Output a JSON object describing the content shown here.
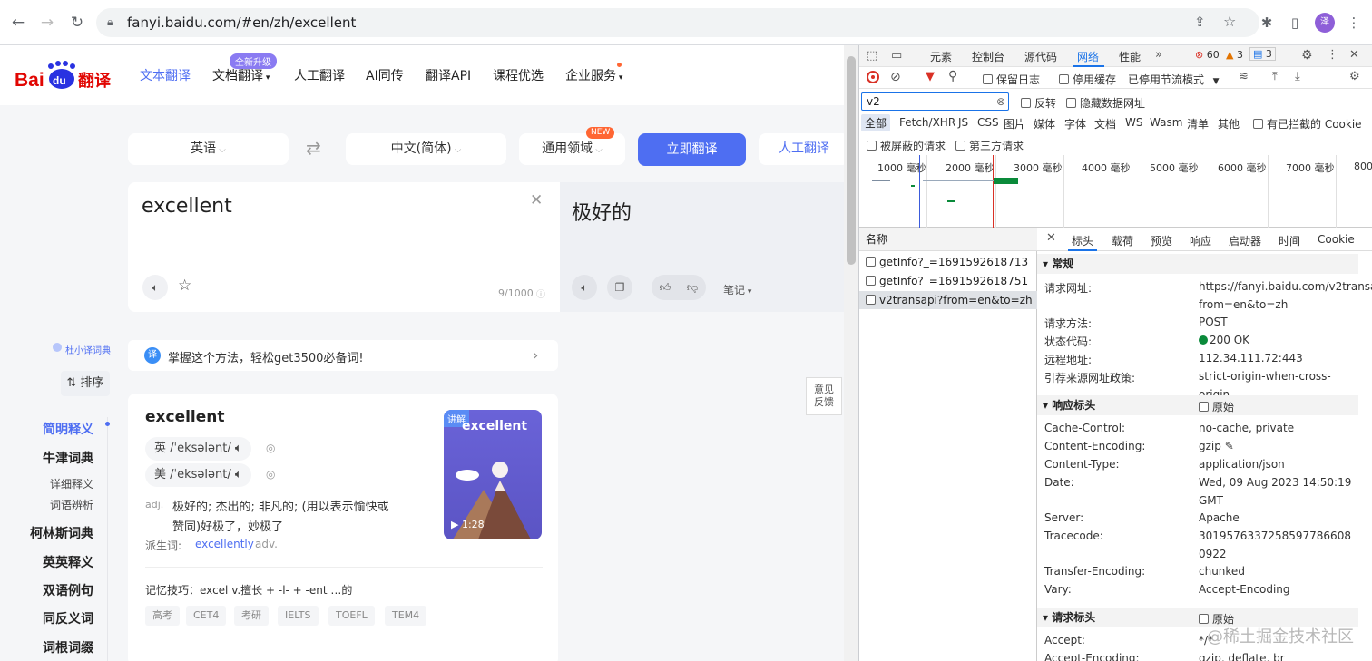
{
  "browser": {
    "url": "fanyi.baidu.com/#en/zh/excellent",
    "profile_initial": "泽"
  },
  "nav": {
    "items": [
      "文本翻译",
      "文档翻译",
      "人工翻译",
      "AI同传",
      "翻译API",
      "课程优选",
      "企业服务"
    ],
    "doc_badge": "全新升级"
  },
  "translator": {
    "source_lang": "英语",
    "target_lang": "中文(简体)",
    "domain": "通用领域",
    "domain_badge": "NEW",
    "translate_button": "立即翻译",
    "human_button": "人工翻译",
    "source_text": "excellent",
    "target_text": "极好的",
    "char_count": "9/1000",
    "notes_label": "笔记"
  },
  "banner": {
    "text": "掌握这个方法，轻松get3500必备词!"
  },
  "sidebar": {
    "dict_label": "杜小译词典",
    "sort_label": "排序",
    "items": [
      "简明释义",
      "牛津词典",
      "详细释义",
      "词语辨析",
      "柯林斯词典",
      "英英释义",
      "双语例句",
      "同反义词",
      "词根词缀"
    ]
  },
  "dict": {
    "word": "excellent",
    "uk_phon": "英 /ˈeksələnt/",
    "us_phon": "美 /ˈeksələnt/",
    "pos": "adj.",
    "meaning_line1": "极好的;  杰出的;  非凡的;  (用以表示愉快或",
    "meaning_line2": "赞同)好极了，妙极了",
    "derived_label": "派生词:",
    "derived_word": "excellently",
    "derived_pos": "adv.",
    "mnemonic": "记忆技巧：excel v.擅长 + -l- + -ent …的",
    "tags": [
      "高考",
      "CET4",
      "考研",
      "IELTS",
      "TOEFL",
      "TEM4"
    ],
    "video_badge": "讲解",
    "video_title": "excellent",
    "video_duration": "1:28"
  },
  "feedback": {
    "line1": "意见",
    "line2": "反馈"
  },
  "devtools": {
    "tabs": [
      "元素",
      "控制台",
      "源代码",
      "网络",
      "性能"
    ],
    "error_count": "60",
    "warning_count": "3",
    "info_count": "3",
    "toolbar": {
      "preserve_log": "保留日志",
      "disable_cache": "停用缓存",
      "throttle": "已停用节流模式"
    },
    "filter_value": "v2",
    "invert": "反转",
    "hide_data_urls": "隐藏数据网址",
    "type_filters": [
      "全部",
      "Fetch/XHR",
      "JS",
      "CSS",
      "图片",
      "媒体",
      "字体",
      "文档",
      "WS",
      "Wasm",
      "清单",
      "其他"
    ],
    "blocked_cookies": "有已拦截的 Cookie",
    "blocked_requests": "被屏蔽的请求",
    "third_party": "第三方请求",
    "timeline_labels": [
      "1000 毫秒",
      "2000 毫秒",
      "3000 毫秒",
      "4000 毫秒",
      "5000 毫秒",
      "6000 毫秒",
      "7000 毫秒",
      "800"
    ],
    "list_header": "名称",
    "requests": [
      "getInfo?_=1691592618713",
      "getInfo?_=1691592618751",
      "v2transapi?from=en&to=zh"
    ],
    "detail_tabs": [
      "标头",
      "载荷",
      "预览",
      "响应",
      "启动器",
      "时间",
      "Cookie"
    ],
    "general": {
      "title": "常规",
      "rows": [
        {
          "k": "请求网址:",
          "v": "https://fanyi.baidu.com/v2transapi?from=en&to=zh"
        },
        {
          "k": "请求方法:",
          "v": "POST"
        },
        {
          "k": "状态代码:",
          "v": "200 OK"
        },
        {
          "k": "远程地址:",
          "v": "112.34.111.72:443"
        },
        {
          "k": "引荐来源网址政策:",
          "v": "strict-origin-when-cross-origin"
        }
      ]
    },
    "response_headers": {
      "title": "响应标头",
      "raw": "原始",
      "rows": [
        {
          "k": "Cache-Control:",
          "v": "no-cache, private"
        },
        {
          "k": "Content-Encoding:",
          "v": "gzip"
        },
        {
          "k": "Content-Type:",
          "v": "application/json"
        },
        {
          "k": "Date:",
          "v": "Wed, 09 Aug 2023 14:50:19 GMT"
        },
        {
          "k": "Server:",
          "v": "Apache"
        },
        {
          "k": "Tracecode:",
          "v": "30195763372585977866080922"
        },
        {
          "k": "Transfer-Encoding:",
          "v": "chunked"
        },
        {
          "k": "Vary:",
          "v": "Accept-Encoding"
        }
      ]
    },
    "request_headers": {
      "title": "请求标头",
      "raw": "原始",
      "rows": [
        {
          "k": "Accept:",
          "v": "*/*"
        },
        {
          "k": "Accept-Encoding:",
          "v": "gzip, deflate, br"
        }
      ]
    }
  },
  "watermark": "@稀土掘金技术社区"
}
